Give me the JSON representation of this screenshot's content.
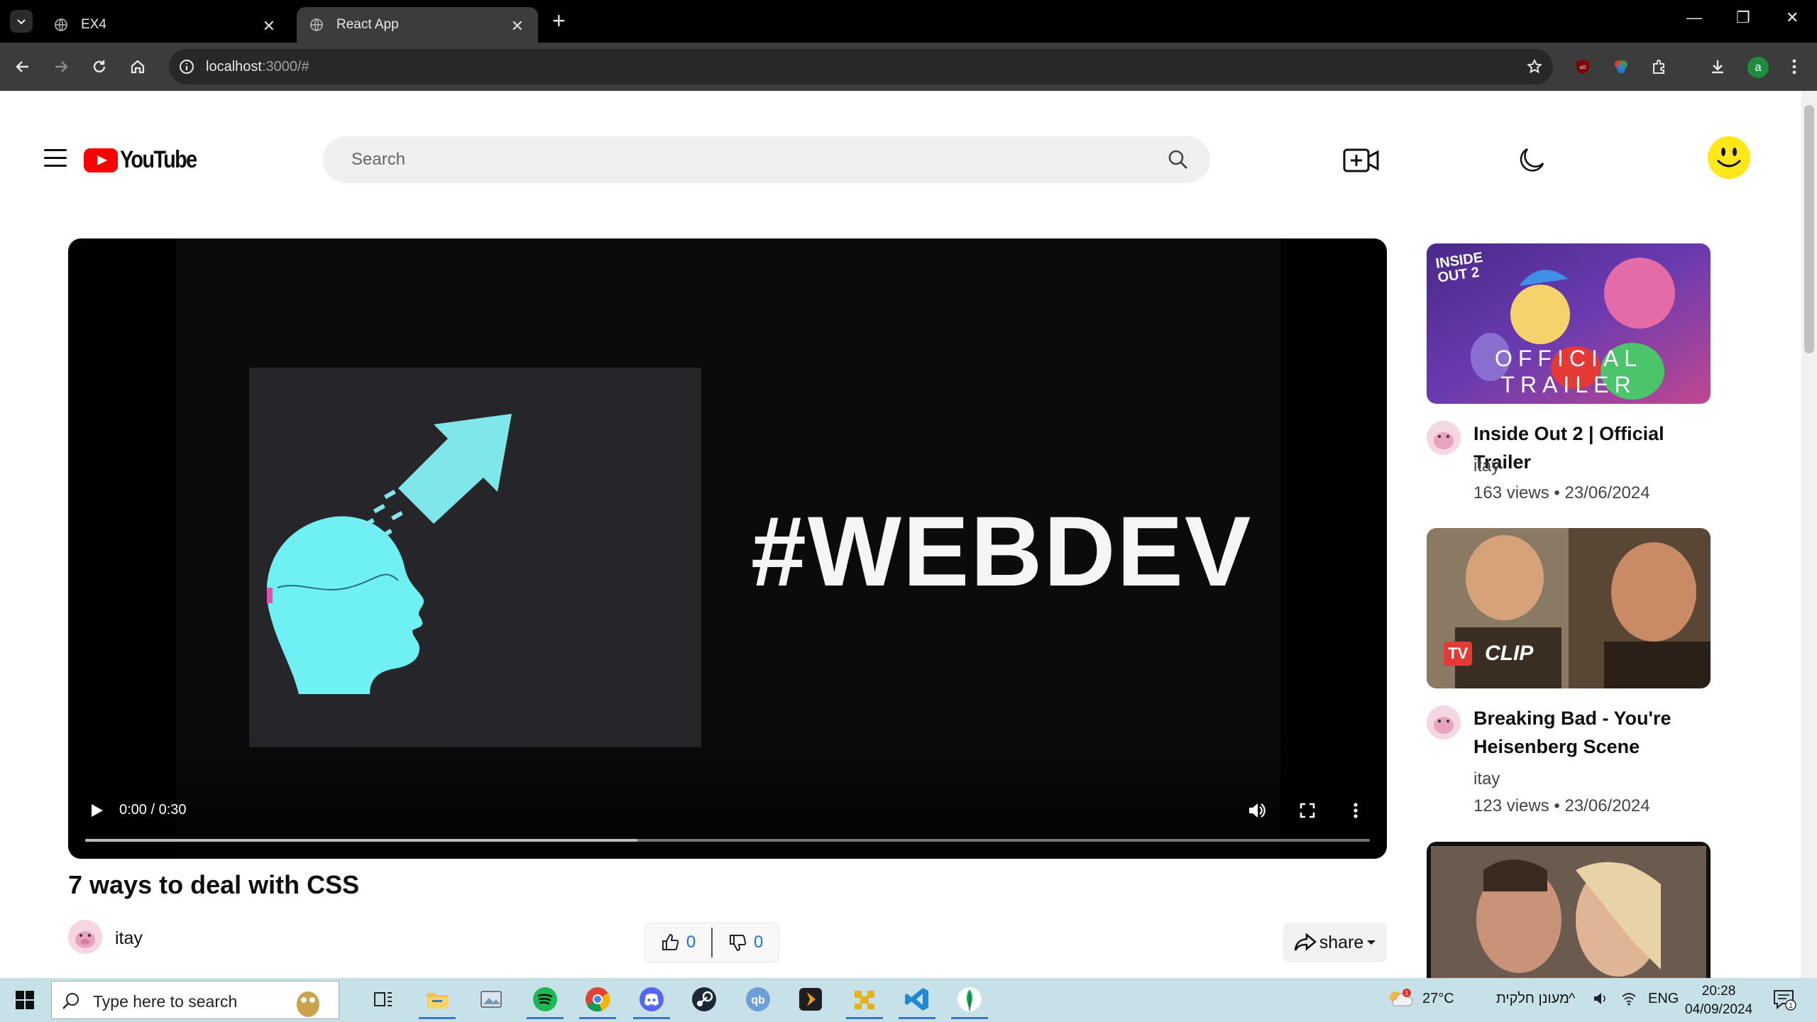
{
  "browser": {
    "tabs": [
      {
        "title": "EX4"
      },
      {
        "title": "React App"
      }
    ],
    "url_host": "localhost",
    "url_rest": ":3000/#",
    "profile_initial": "a"
  },
  "header": {
    "logo_text": "YouTube",
    "search_placeholder": "Search"
  },
  "player": {
    "overlay_text": "#WEBDEV",
    "time": "0:00 / 0:30",
    "buffered_fraction": 0.43
  },
  "video": {
    "title": "7 ways to deal with CSS",
    "channel": "itay",
    "likes": "0",
    "dislikes": "0",
    "share_label": "share"
  },
  "recommendations": [
    {
      "title": "Inside Out 2 | Official Trailer",
      "channel": "itay",
      "views": "163 views",
      "date": "23/06/2024",
      "thumb_caption": "OFFICIAL TRAILER",
      "thumb_tag": "INSIDE OUT 2"
    },
    {
      "title": "Breaking Bad - You're Heisenberg Scene",
      "channel": "itay",
      "views": "123 views",
      "date": "23/06/2024",
      "thumb_caption": "CLIP",
      "thumb_tag": "TV"
    },
    {
      "title": "",
      "channel": "",
      "views": "",
      "date": ""
    }
  ],
  "taskbar": {
    "search_text": "Type here to search",
    "weather": "27°C",
    "weather_desc": "מעונן חלקית",
    "lang": "ENG",
    "time": "20:28",
    "date": "04/09/2024",
    "notif_count": "1"
  },
  "colors": {
    "youtube_red": "#ff0000",
    "like_blue": "#1a73e8",
    "taskbar": "#c7e1e8"
  }
}
